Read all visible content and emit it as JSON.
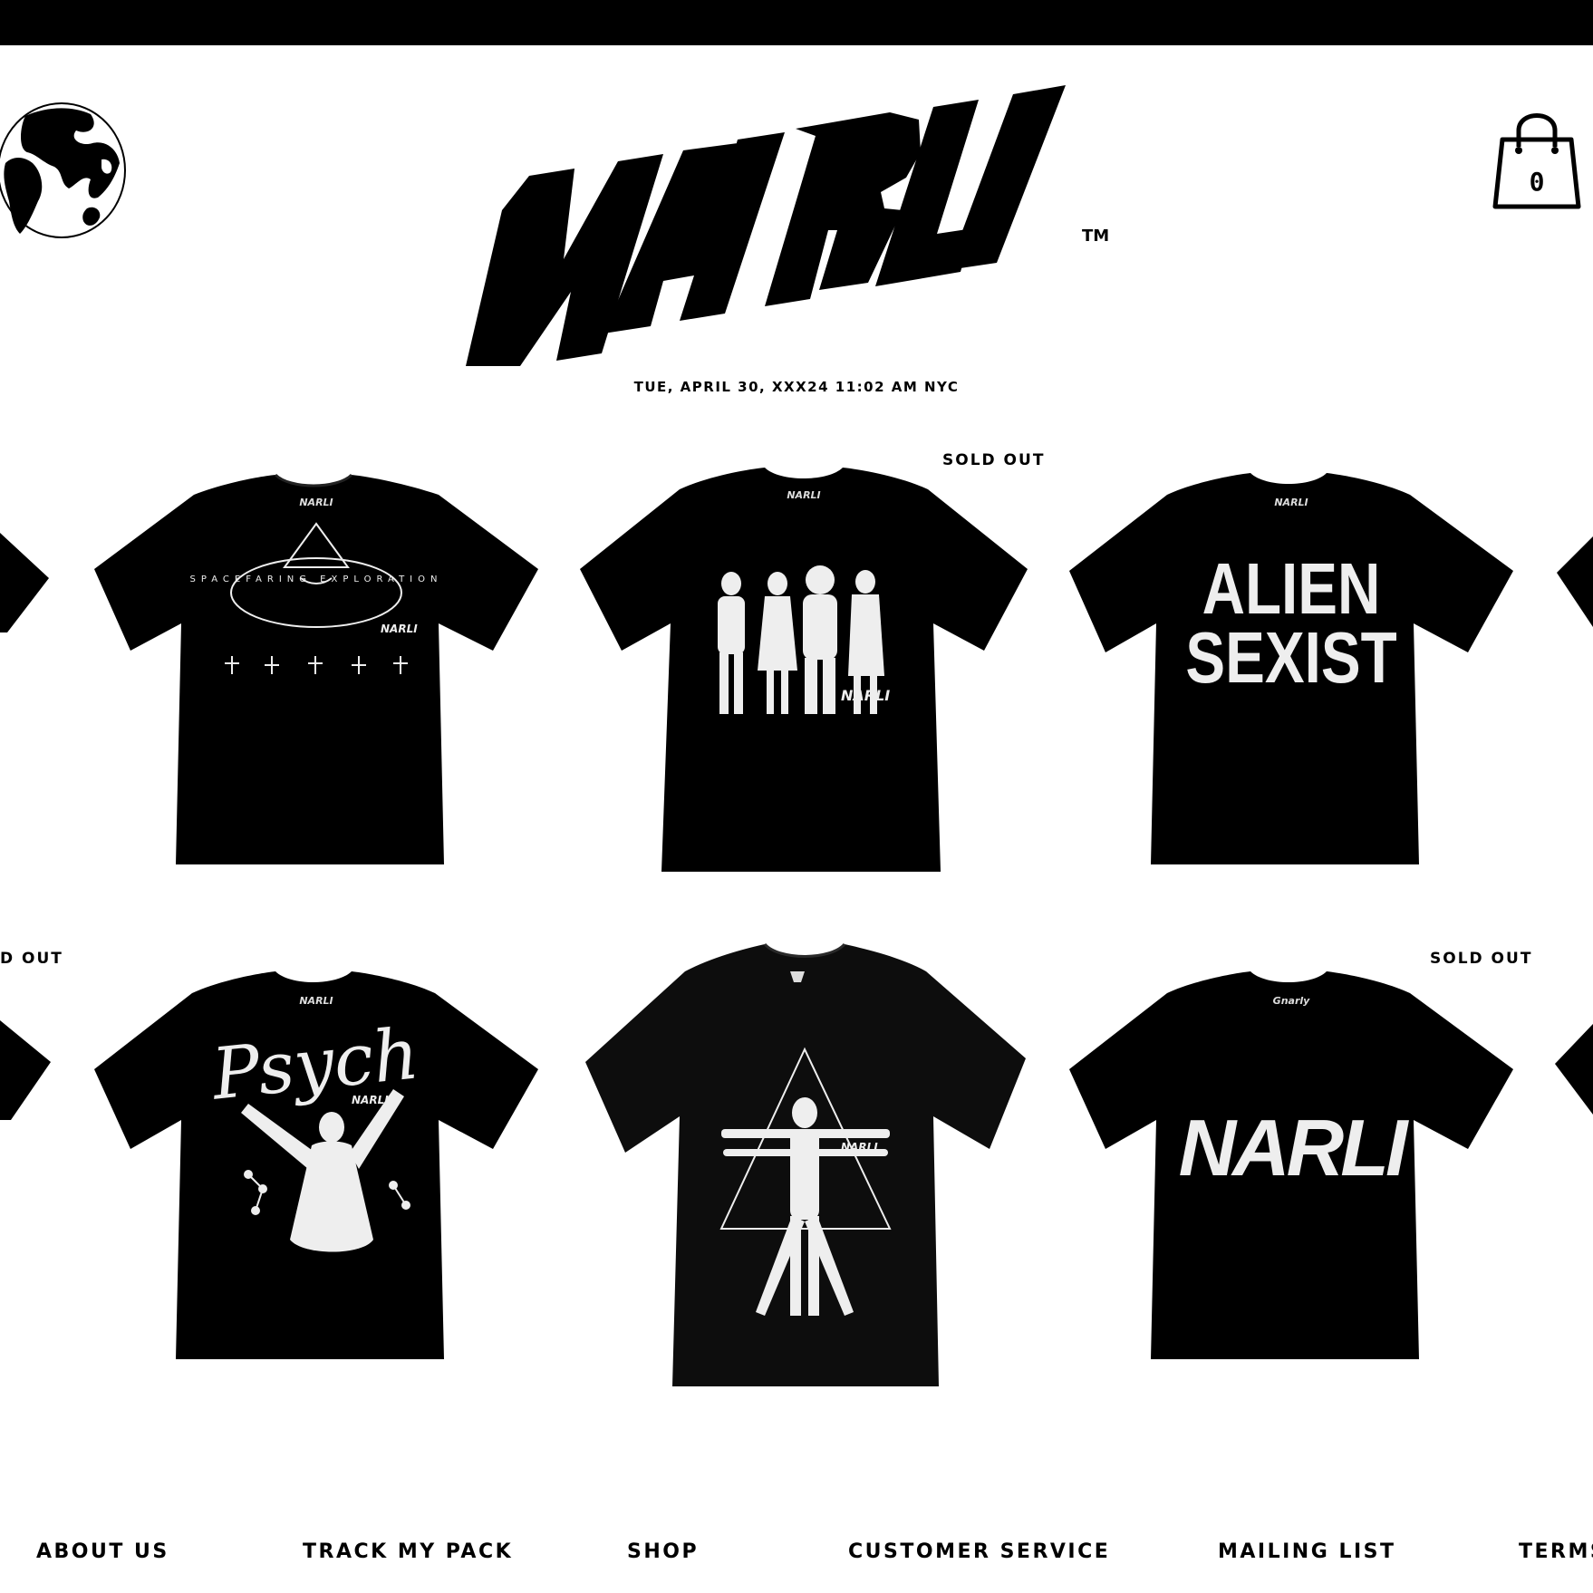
{
  "brand": {
    "logo_text": "NARLI",
    "tm": "™"
  },
  "header": {
    "datetime": "TUE, APRIL 30, XXX24 11:02 AM NYC",
    "cart_count": "0",
    "globe_icon": "globe-icon",
    "cart_icon": "shopping-bag-icon"
  },
  "products": {
    "row1": [
      {
        "print": "SPACEFARING EXPLORATION",
        "tag": "NARLI",
        "sold_out": ""
      },
      {
        "print": "NARLI",
        "tag": "NARLI",
        "sold_out": "SOLD OUT"
      },
      {
        "print_line1": "ALIEN",
        "print_line2": "SEXIST",
        "tag": "NARLI",
        "sold_out": ""
      }
    ],
    "row2": [
      {
        "print": "Psych",
        "tag": "NARLI",
        "sold_out": "D OUT"
      },
      {
        "print": "NARLI",
        "tag": "",
        "sold_out": ""
      },
      {
        "print": "NARLI",
        "tag": "Gnarly",
        "sold_out": "SOLD OUT"
      }
    ]
  },
  "footer": {
    "about": "ABOUT US",
    "track": "TRACK MY PACK",
    "shop": "SHOP",
    "service": "CUSTOMER SERVICE",
    "mailing": "MAILING LIST",
    "terms": "TERMS"
  },
  "colors": {
    "ink": "#000000",
    "paper": "#ffffff",
    "print": "#f2f2f2"
  }
}
